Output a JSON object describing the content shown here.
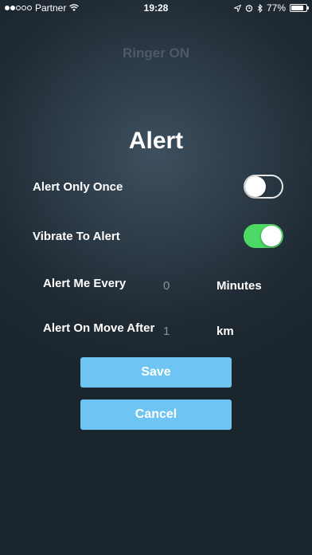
{
  "status_bar": {
    "carrier": "Partner",
    "time": "19:28",
    "battery": "77%",
    "battery_level": 0.77,
    "icons": [
      "signal-dots-icon",
      "wifi-icon",
      "location-icon",
      "alarm-icon",
      "bluetooth-icon",
      "battery-icon"
    ]
  },
  "header": {
    "ringer_status": "Ringer ON"
  },
  "title": "Alert",
  "settings": {
    "alert_once": {
      "label": "Alert Only Once",
      "enabled": false
    },
    "vibrate": {
      "label": "Vibrate To Alert",
      "enabled": true
    },
    "alert_every": {
      "label": "Alert Me Every",
      "value": "0",
      "unit": "Minutes"
    },
    "alert_on_move": {
      "label": "Alert On Move After",
      "value": "1",
      "unit": "km"
    }
  },
  "buttons": {
    "save": "Save",
    "cancel": "Cancel"
  },
  "colors": {
    "toggle_on": "#4cd964",
    "button": "#6ec4f2",
    "ringer_text": "#4d5a65"
  }
}
